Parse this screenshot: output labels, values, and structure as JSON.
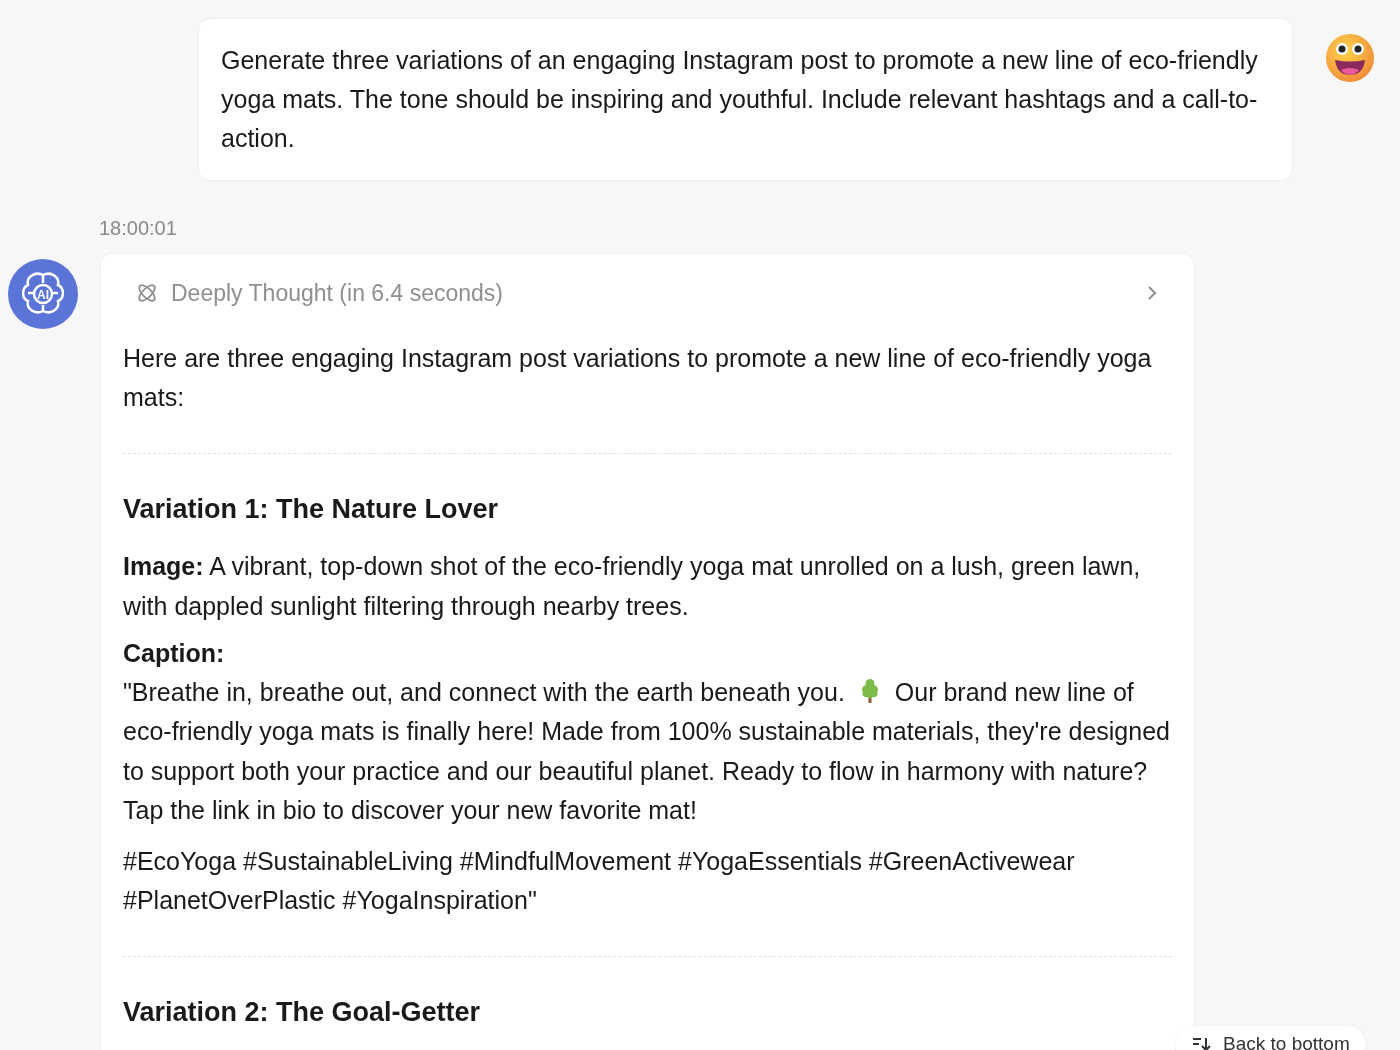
{
  "user_message": {
    "text": "Generate three variations of an engaging Instagram post to promote a new line of eco-friendly yoga mats. The tone should be inspiring and youthful. Include relevant hashtags and a call-to-action."
  },
  "timestamp": "18:00:01",
  "ai_avatar_label": "AI",
  "reply": {
    "thought": {
      "label": "Deeply Thought (in 6.4 seconds)",
      "expanded": false
    },
    "intro": "Here are three engaging Instagram post variations to promote a new line of eco-friendly yoga mats:",
    "sections": [
      {
        "heading": "Variation 1: The Nature Lover",
        "image_text": "**Image:** A vibrant, top-down shot of the eco-friendly yoga mat unrolled on a lush, green lawn, with dappled sunlight filtering through nearby trees.",
        "caption_label": "Caption:",
        "caption_before": "\"Breathe in, breathe out, and connect with the earth beneath you.",
        "caption_after": "Our brand new line of eco-friendly yoga mats is finally here! Made from 100% sustainable materials, they're designed to support both your practice and our beautiful planet. Ready to flow in harmony with nature? Tap the link in bio to discover your new favorite mat!",
        "hashtags": "#EcoYoga #SustainableLiving #MindfulMovement #YogaEssentials #GreenActivewear #PlanetOverPlastic #YogaInspiration\""
      },
      {
        "heading": "Variation 2: The Goal-Getter"
      }
    ]
  },
  "back_to_bottom": "Back to bottom"
}
